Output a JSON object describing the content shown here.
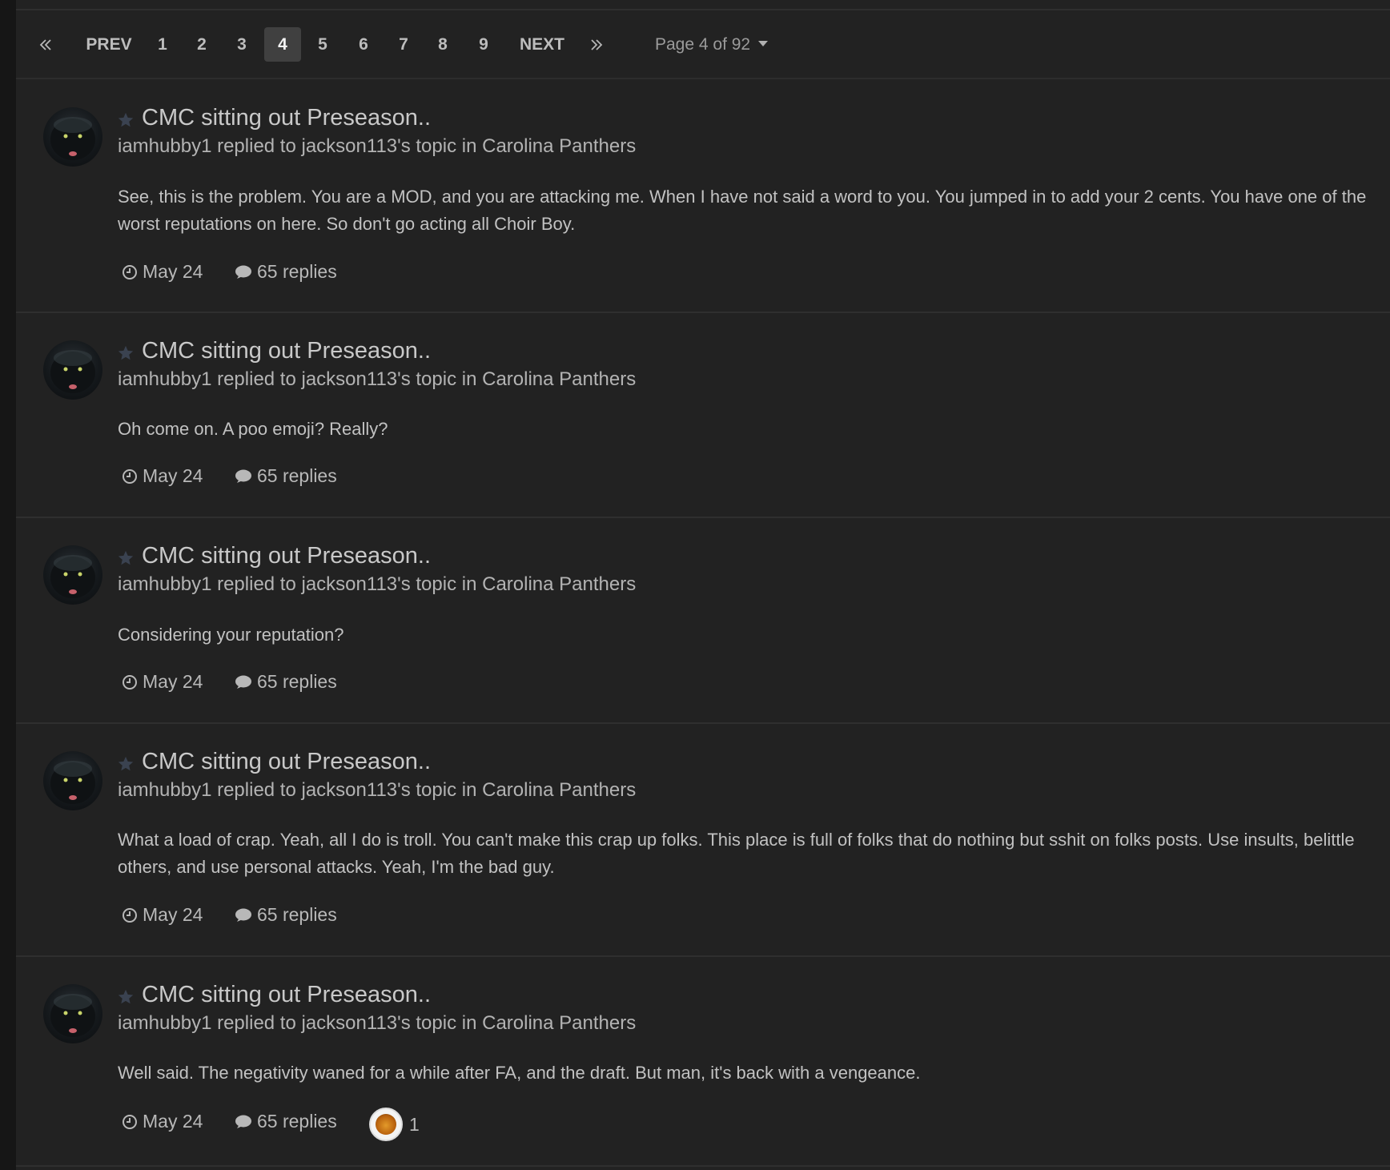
{
  "pagination": {
    "prev": "PREV",
    "next": "NEXT",
    "pages": [
      "1",
      "2",
      "3",
      "4",
      "5",
      "6",
      "7",
      "8",
      "9"
    ],
    "active_page": "4",
    "page_jump": "Page 4 of 92"
  },
  "entries": [
    {
      "title": "CMC sitting out Preseason..",
      "author": "iamhubby1",
      "replied_to": " replied to ",
      "topic_owner": "jackson113's topic",
      "in_text": " in ",
      "forum": "Carolina Panthers",
      "body": "See, this is the problem. You are a MOD, and you are attacking me. When I have not said a word to you. You jumped in to add your 2 cents. You have one of the worst reputations on here. So don't go acting all Choir Boy.",
      "date": "May 24",
      "replies": "65 replies"
    },
    {
      "title": "CMC sitting out Preseason..",
      "author": "iamhubby1",
      "replied_to": " replied to ",
      "topic_owner": "jackson113's topic",
      "in_text": " in ",
      "forum": "Carolina Panthers",
      "body": "Oh come on. A poo emoji? Really?",
      "date": "May 24",
      "replies": "65 replies"
    },
    {
      "title": "CMC sitting out Preseason..",
      "author": "iamhubby1",
      "replied_to": " replied to ",
      "topic_owner": "jackson113's topic",
      "in_text": " in ",
      "forum": "Carolina Panthers",
      "body": "Considering your reputation?",
      "date": "May 24",
      "replies": "65 replies"
    },
    {
      "title": "CMC sitting out Preseason..",
      "author": "iamhubby1",
      "replied_to": " replied to ",
      "topic_owner": "jackson113's topic",
      "in_text": " in ",
      "forum": "Carolina Panthers",
      "body": "What a load of crap. Yeah, all I do is troll. You can't make this crap up folks. This place is full of folks that do nothing but sshit on folks posts. Use insults, belittle others, and use personal attacks. Yeah, I'm the bad guy.",
      "date": "May 24",
      "replies": "65 replies"
    },
    {
      "title": "CMC sitting out Preseason..",
      "author": "iamhubby1",
      "replied_to": " replied to ",
      "topic_owner": "jackson113's topic",
      "in_text": " in ",
      "forum": "Carolina Panthers",
      "body": "Well said. The negativity waned for a while after FA, and the draft. But man, it's back with a vengeance.",
      "date": "May 24",
      "replies": "65 replies",
      "reaction_count": "1"
    }
  ],
  "icons": {
    "first_page": "double-chevron-left-icon",
    "last_page": "double-chevron-right-icon",
    "star": "star-icon",
    "clock": "clock-icon",
    "comment": "comment-bubble-icon",
    "reaction": "beer-reaction-icon"
  }
}
